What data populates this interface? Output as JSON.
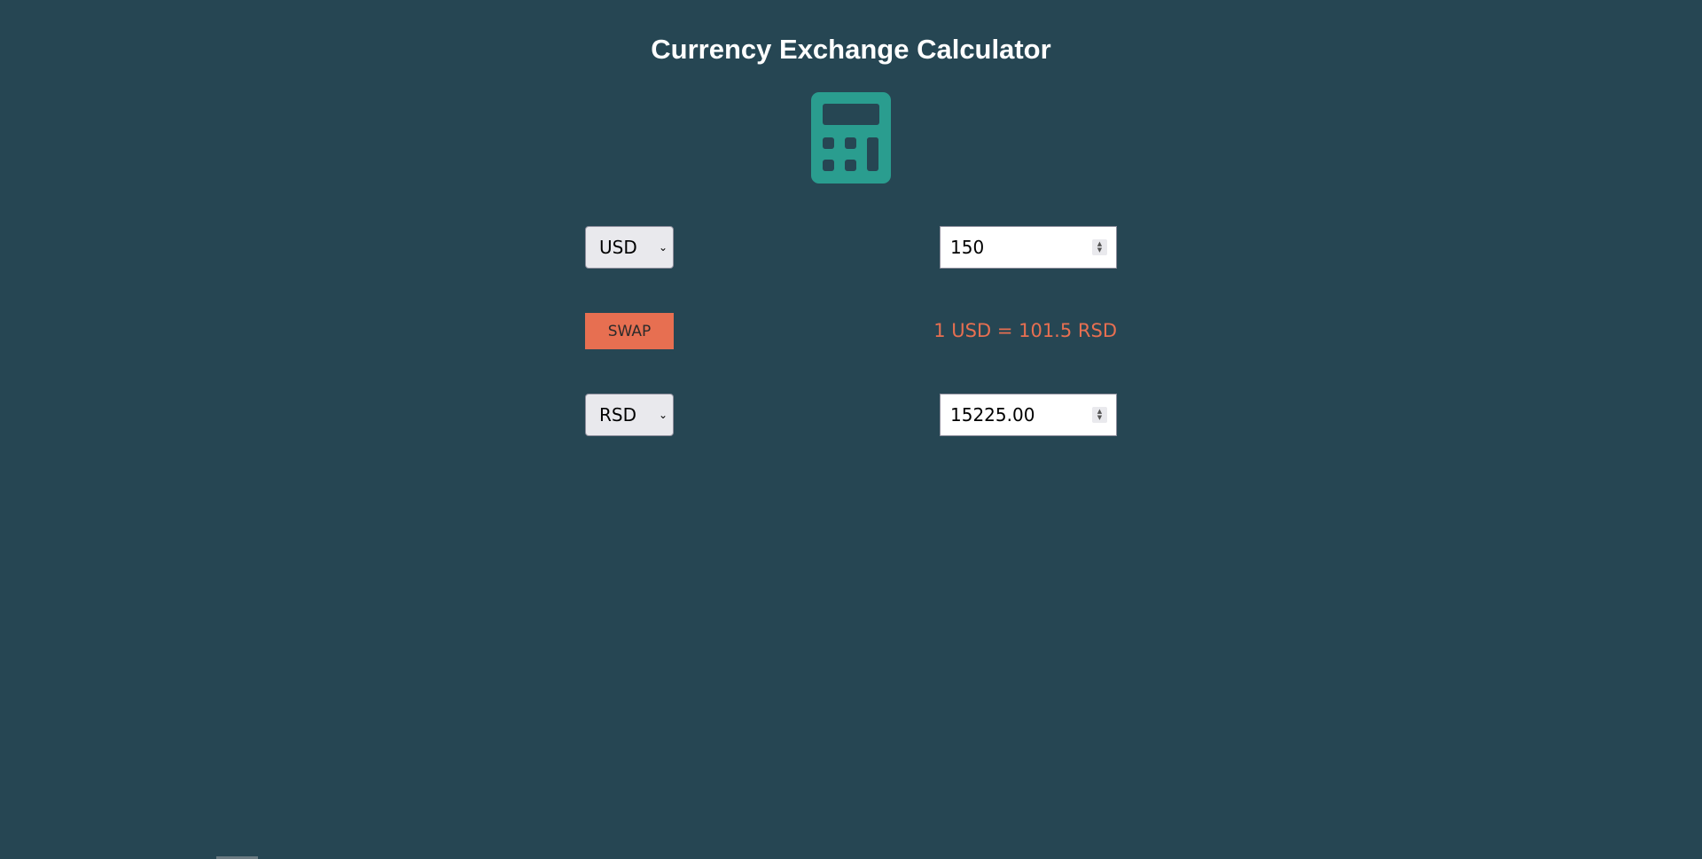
{
  "header": {
    "title": "Currency Exchange Calculator"
  },
  "icon": {
    "name": "calculator-icon",
    "color": "#2a9d8f"
  },
  "from": {
    "currency": "USD",
    "amount": "150"
  },
  "to": {
    "currency": "RSD",
    "amount": "15225.00"
  },
  "swap": {
    "label": "SWAP"
  },
  "rate": {
    "text": "1 USD = 101.5 RSD"
  },
  "colors": {
    "background": "#264653",
    "accent": "#e76f51",
    "icon": "#2a9d8f"
  }
}
